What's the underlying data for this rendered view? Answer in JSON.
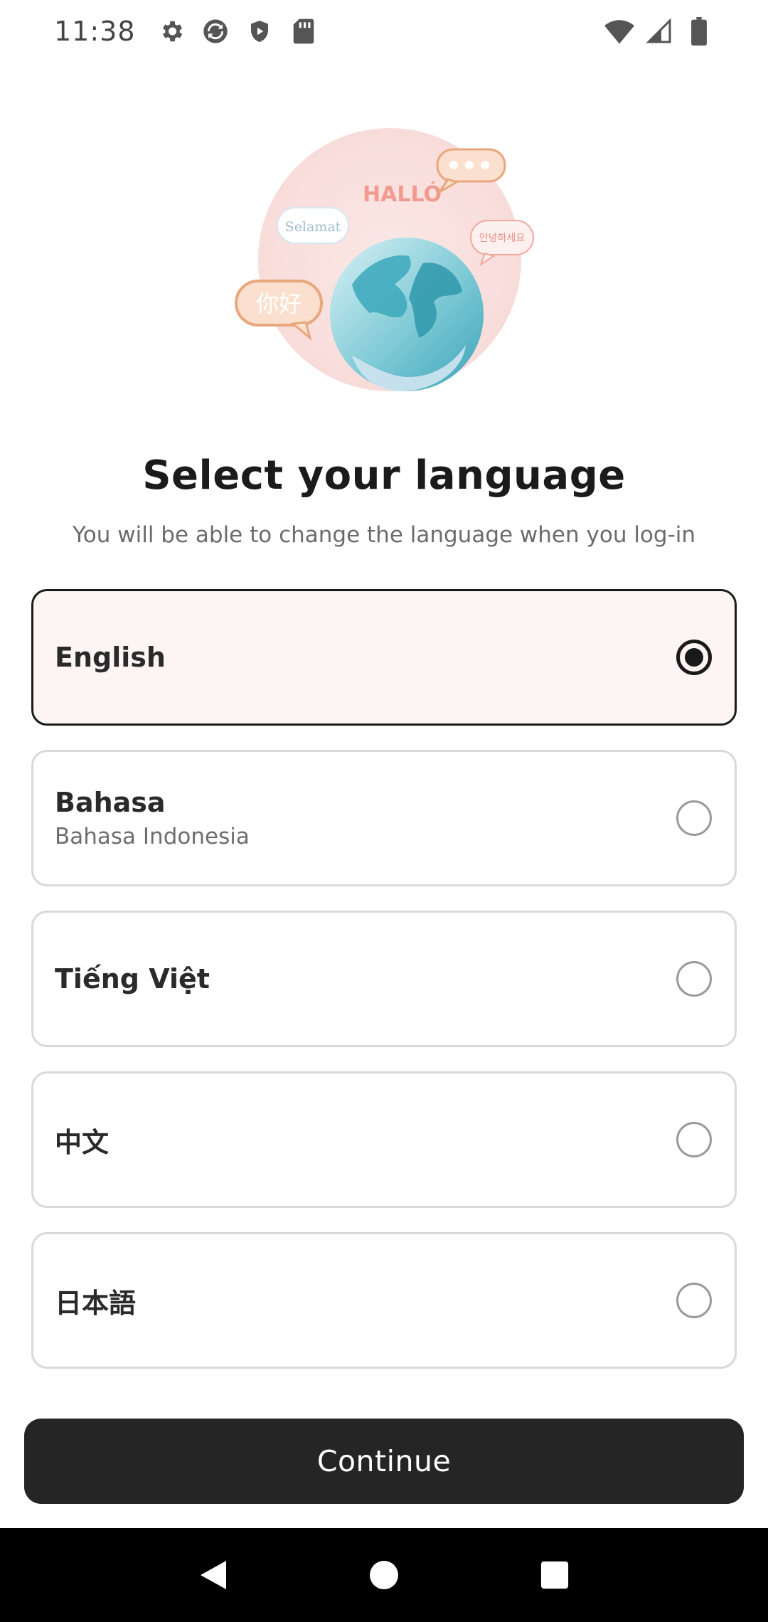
{
  "status_bar": {
    "time": "11:38",
    "left_icons": [
      "settings-icon",
      "sync-icon",
      "shield-icon",
      "sd-card-icon"
    ],
    "right_icons": [
      "wifi-icon",
      "signal-icon",
      "battery-icon"
    ]
  },
  "illustration": {
    "bubbles": [
      "HALLO",
      "Selamat",
      "你好",
      "안녕하세요"
    ]
  },
  "header": {
    "title": "Select your language",
    "subtitle": "You will be able to change the language when you log-in"
  },
  "languages": [
    {
      "label": "English",
      "sub": "",
      "selected": true
    },
    {
      "label": "Bahasa",
      "sub": "Bahasa Indonesia",
      "selected": false
    },
    {
      "label": "Tiếng Việt",
      "sub": "",
      "selected": false
    },
    {
      "label": "中文",
      "sub": "",
      "selected": false
    },
    {
      "label": "日本語",
      "sub": "",
      "selected": false
    }
  ],
  "footer": {
    "continue_label": "Continue"
  },
  "colors": {
    "selected_bg": "#fdf5f4",
    "button_bg": "#252525",
    "accent_pink": "#f29a8e"
  },
  "nav_bar": {
    "icons": [
      "back-icon",
      "home-icon",
      "recents-icon"
    ]
  }
}
